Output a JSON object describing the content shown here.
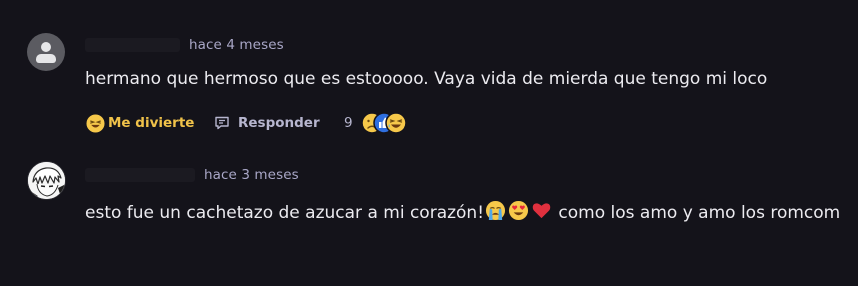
{
  "comments": [
    {
      "timestamp": "hace 4 meses",
      "text": "hermano que hermoso que es estooooo. Vaya vida de mierda que tengo mi loco",
      "reaction_label": "Me divierte",
      "reply_label": "Responder",
      "reaction_count": "9",
      "avatar_icon": "default-user-icon",
      "reactions": [
        "sad-face-icon",
        "thumbs-up-icon",
        "laughing-face-icon"
      ]
    },
    {
      "timestamp": "hace 3 meses",
      "text_before_emoji": "esto fue un cachetazo de azucar a mi corazón!",
      "text_after_emoji": " como los amo y amo los romcom",
      "avatar_icon": "anime-avatar-icon",
      "inline_emojis": [
        "crying-face-icon",
        "heart-eyes-icon",
        "red-heart-icon"
      ]
    }
  ],
  "colors": {
    "background": "#14131a",
    "text": "#ecebf0",
    "timestamp": "#a9a7c7",
    "reaction_accent": "#f0c24a",
    "muted": "#b7b6cf"
  }
}
